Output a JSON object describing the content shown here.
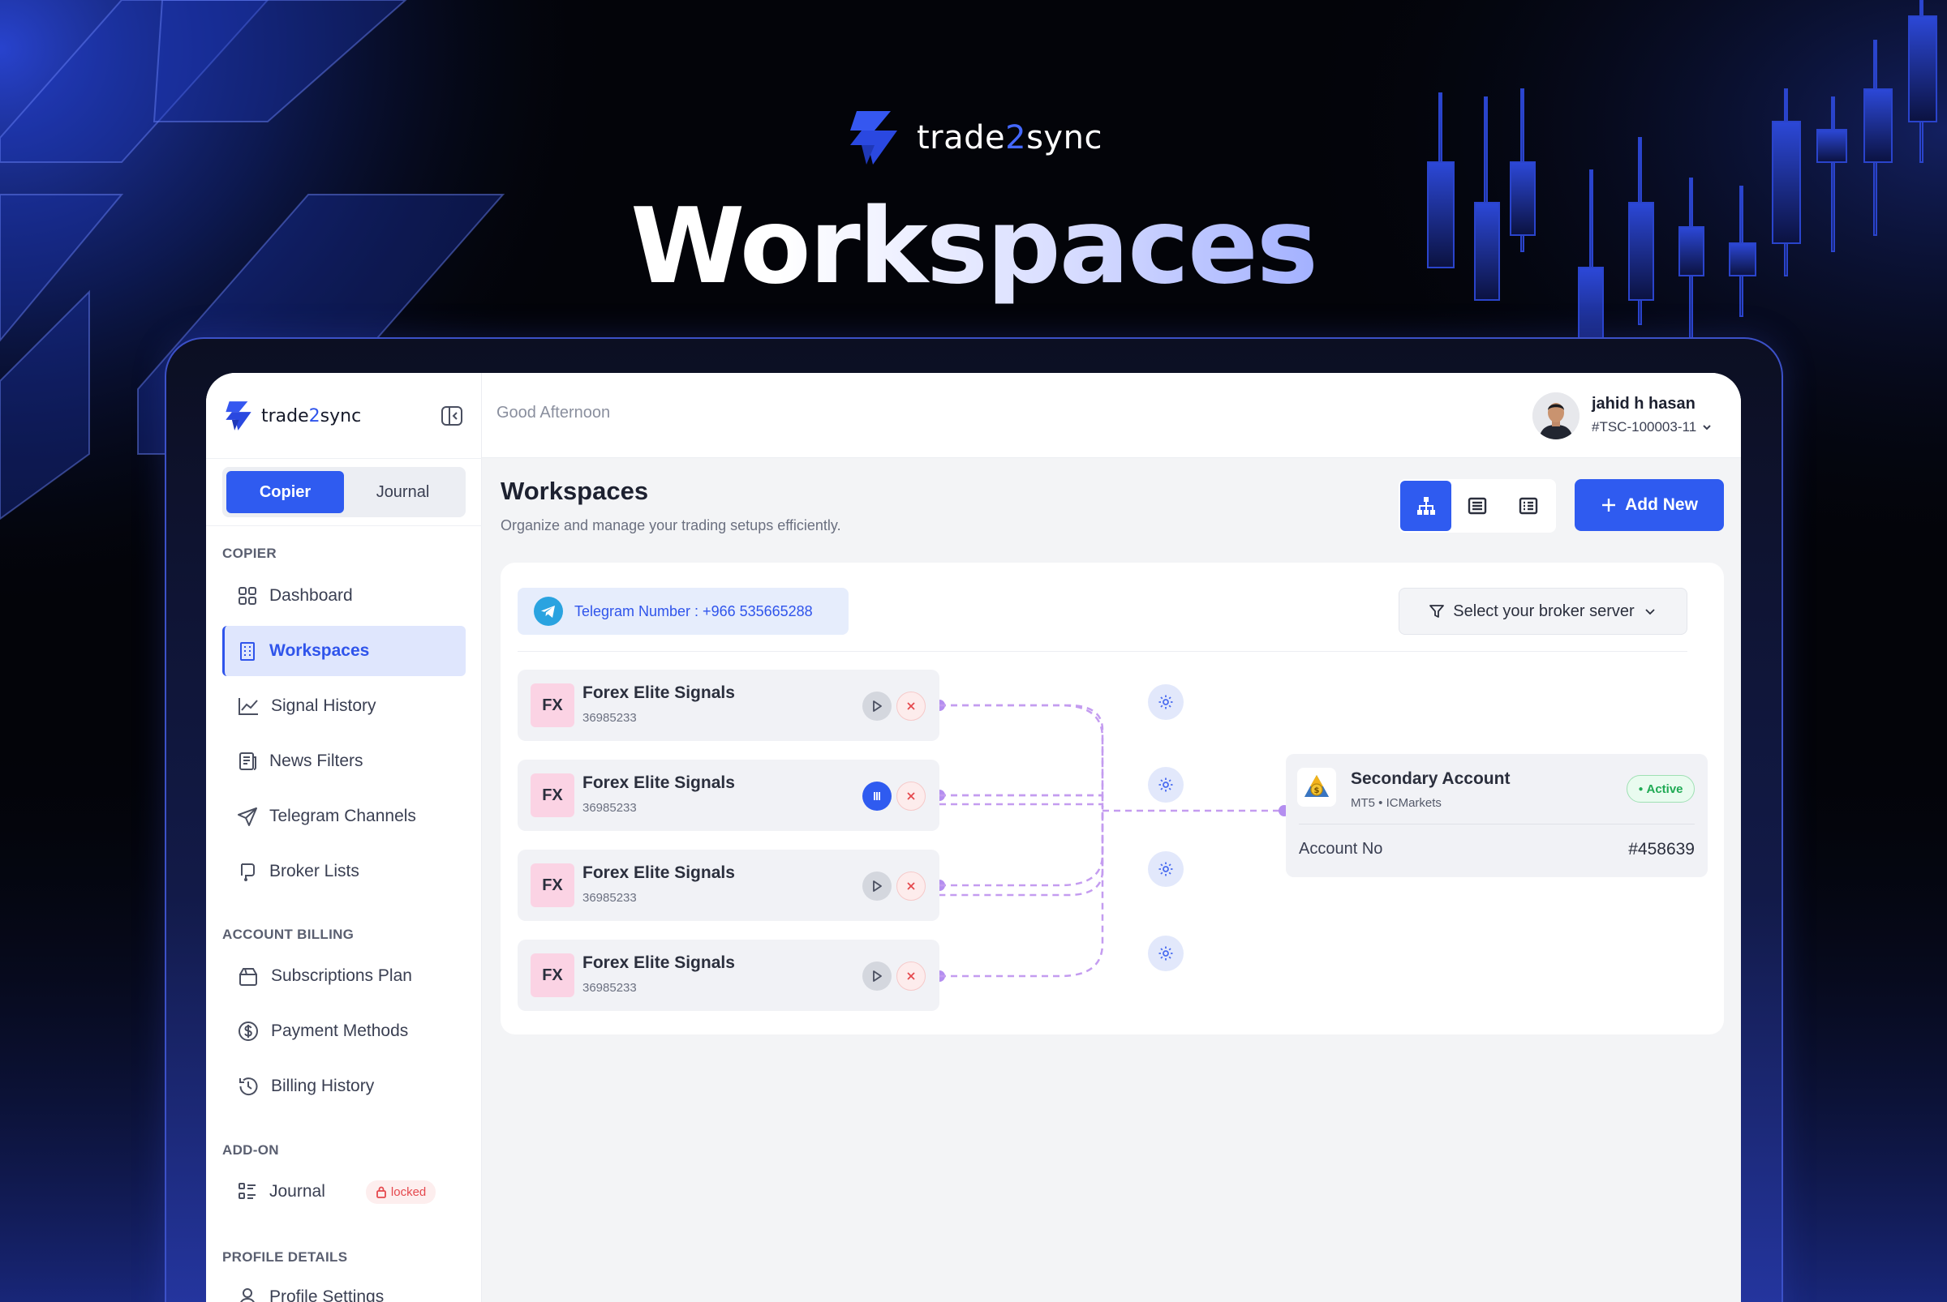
{
  "hero": {
    "brand_prefix": "trade",
    "brand_two": "2",
    "brand_suffix": "sync",
    "title": "Workspaces"
  },
  "sidebar": {
    "brand_prefix": "trade",
    "brand_two": "2",
    "brand_suffix": "sync",
    "mode_tabs": [
      {
        "label": "Copier",
        "active": true
      },
      {
        "label": "Journal",
        "active": false
      }
    ],
    "sections": [
      {
        "label": "COPIER",
        "items": [
          {
            "label": "Dashboard",
            "icon": "grid-icon"
          },
          {
            "label": "Workspaces",
            "icon": "building-icon",
            "active": true
          },
          {
            "label": "Signal History",
            "icon": "chart-line-icon"
          },
          {
            "label": "News Filters",
            "icon": "news-icon"
          },
          {
            "label": "Telegram Channels",
            "icon": "send-icon"
          },
          {
            "label": "Broker Lists",
            "icon": "broker-icon"
          }
        ]
      },
      {
        "label": "ACCOUNT BILLING",
        "items": [
          {
            "label": "Subscriptions Plan",
            "icon": "box-icon"
          },
          {
            "label": "Payment Methods",
            "icon": "dollar-icon"
          },
          {
            "label": "Billing History",
            "icon": "history-icon"
          }
        ]
      },
      {
        "label": "ADD-ON",
        "items": [
          {
            "label": "Journal",
            "icon": "list-icon",
            "badge": "locked"
          }
        ]
      },
      {
        "label": "PROFILE DETAILS",
        "items": [
          {
            "label": "Profile Settings",
            "icon": "user-icon"
          }
        ]
      }
    ]
  },
  "topbar": {
    "greeting": "Good Afternoon",
    "user_name": "jahid h hasan",
    "user_id": "#TSC-100003-11"
  },
  "main": {
    "title": "Workspaces",
    "subtitle": "Organize and manage your trading setups efficiently.",
    "view_modes": [
      {
        "icon": "hierarchy-icon",
        "active": true
      },
      {
        "icon": "rows-icon",
        "active": false
      },
      {
        "icon": "checklist-icon",
        "active": false
      }
    ],
    "add_button": "Add New",
    "telegram": "Telegram Number : +966 535665288",
    "broker_select": "Select your broker server",
    "signals": [
      {
        "badge": "FX",
        "name": "Forex Elite Signals",
        "id": "36985233",
        "status": "paused"
      },
      {
        "badge": "FX",
        "name": "Forex Elite Signals",
        "id": "36985233",
        "status": "running"
      },
      {
        "badge": "FX",
        "name": "Forex Elite Signals",
        "id": "36985233",
        "status": "paused"
      },
      {
        "badge": "FX",
        "name": "Forex Elite Signals",
        "id": "36985233",
        "status": "paused"
      }
    ],
    "account": {
      "name": "Secondary Account",
      "meta": "MT5 • ICMarkets",
      "status": "Active",
      "label": "Account No",
      "number": "#458639"
    }
  },
  "colors": {
    "accent": "#2f5bf0",
    "background": "#030409",
    "connector": "#c49cf0",
    "active_green": "#1faa54",
    "locked_red": "#e5484d"
  }
}
